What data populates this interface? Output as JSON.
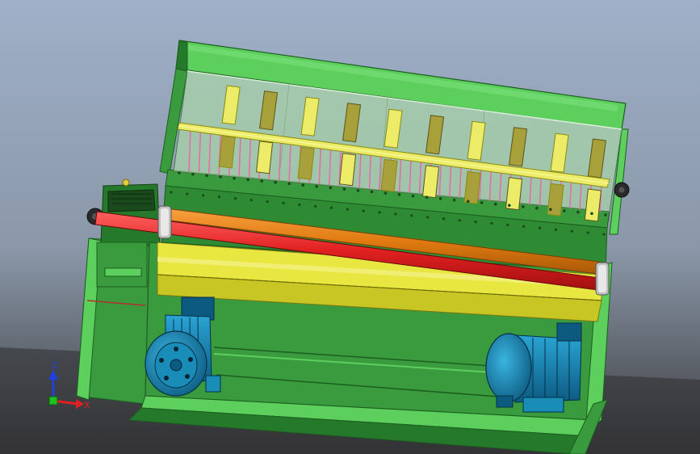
{
  "viewport": {
    "background_top": "#9fb0c8",
    "background_bottom": "#3a3a3c"
  },
  "colors": {
    "frame_green": "#3a9a3e",
    "frame_light_green": "#5ccf5c",
    "frame_dark_green": "#247a2a",
    "beam_yellow": "#d9d72a",
    "beam_dark_yellow": "#9c9a16",
    "guard_glass": "#a8d4a8",
    "blade_yellow": "#ecec68",
    "spring_pink": "#e070a8",
    "bar_orange": "#e07a10",
    "bar_red": "#e02020",
    "motor_blue": "#1a8cb8",
    "motor_dark_blue": "#0c5a80",
    "fastener_gray": "#888888"
  },
  "model": {
    "name": "shearing-machine-assembly"
  },
  "triad": {
    "z_label": "Z",
    "x_label": "X"
  }
}
